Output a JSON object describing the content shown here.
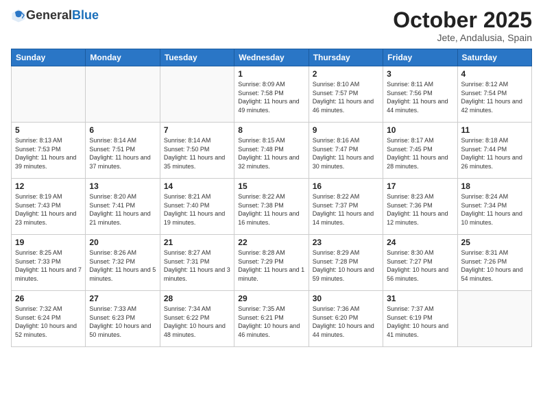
{
  "header": {
    "logo_general": "General",
    "logo_blue": "Blue",
    "month_title": "October 2025",
    "location": "Jete, Andalusia, Spain"
  },
  "days_of_week": [
    "Sunday",
    "Monday",
    "Tuesday",
    "Wednesday",
    "Thursday",
    "Friday",
    "Saturday"
  ],
  "weeks": [
    [
      {
        "day": "",
        "info": ""
      },
      {
        "day": "",
        "info": ""
      },
      {
        "day": "",
        "info": ""
      },
      {
        "day": "1",
        "info": "Sunrise: 8:09 AM\nSunset: 7:58 PM\nDaylight: 11 hours and 49 minutes."
      },
      {
        "day": "2",
        "info": "Sunrise: 8:10 AM\nSunset: 7:57 PM\nDaylight: 11 hours and 46 minutes."
      },
      {
        "day": "3",
        "info": "Sunrise: 8:11 AM\nSunset: 7:56 PM\nDaylight: 11 hours and 44 minutes."
      },
      {
        "day": "4",
        "info": "Sunrise: 8:12 AM\nSunset: 7:54 PM\nDaylight: 11 hours and 42 minutes."
      }
    ],
    [
      {
        "day": "5",
        "info": "Sunrise: 8:13 AM\nSunset: 7:53 PM\nDaylight: 11 hours and 39 minutes."
      },
      {
        "day": "6",
        "info": "Sunrise: 8:14 AM\nSunset: 7:51 PM\nDaylight: 11 hours and 37 minutes."
      },
      {
        "day": "7",
        "info": "Sunrise: 8:14 AM\nSunset: 7:50 PM\nDaylight: 11 hours and 35 minutes."
      },
      {
        "day": "8",
        "info": "Sunrise: 8:15 AM\nSunset: 7:48 PM\nDaylight: 11 hours and 32 minutes."
      },
      {
        "day": "9",
        "info": "Sunrise: 8:16 AM\nSunset: 7:47 PM\nDaylight: 11 hours and 30 minutes."
      },
      {
        "day": "10",
        "info": "Sunrise: 8:17 AM\nSunset: 7:45 PM\nDaylight: 11 hours and 28 minutes."
      },
      {
        "day": "11",
        "info": "Sunrise: 8:18 AM\nSunset: 7:44 PM\nDaylight: 11 hours and 26 minutes."
      }
    ],
    [
      {
        "day": "12",
        "info": "Sunrise: 8:19 AM\nSunset: 7:43 PM\nDaylight: 11 hours and 23 minutes."
      },
      {
        "day": "13",
        "info": "Sunrise: 8:20 AM\nSunset: 7:41 PM\nDaylight: 11 hours and 21 minutes."
      },
      {
        "day": "14",
        "info": "Sunrise: 8:21 AM\nSunset: 7:40 PM\nDaylight: 11 hours and 19 minutes."
      },
      {
        "day": "15",
        "info": "Sunrise: 8:22 AM\nSunset: 7:38 PM\nDaylight: 11 hours and 16 minutes."
      },
      {
        "day": "16",
        "info": "Sunrise: 8:22 AM\nSunset: 7:37 PM\nDaylight: 11 hours and 14 minutes."
      },
      {
        "day": "17",
        "info": "Sunrise: 8:23 AM\nSunset: 7:36 PM\nDaylight: 11 hours and 12 minutes."
      },
      {
        "day": "18",
        "info": "Sunrise: 8:24 AM\nSunset: 7:34 PM\nDaylight: 11 hours and 10 minutes."
      }
    ],
    [
      {
        "day": "19",
        "info": "Sunrise: 8:25 AM\nSunset: 7:33 PM\nDaylight: 11 hours and 7 minutes."
      },
      {
        "day": "20",
        "info": "Sunrise: 8:26 AM\nSunset: 7:32 PM\nDaylight: 11 hours and 5 minutes."
      },
      {
        "day": "21",
        "info": "Sunrise: 8:27 AM\nSunset: 7:31 PM\nDaylight: 11 hours and 3 minutes."
      },
      {
        "day": "22",
        "info": "Sunrise: 8:28 AM\nSunset: 7:29 PM\nDaylight: 11 hours and 1 minute."
      },
      {
        "day": "23",
        "info": "Sunrise: 8:29 AM\nSunset: 7:28 PM\nDaylight: 10 hours and 59 minutes."
      },
      {
        "day": "24",
        "info": "Sunrise: 8:30 AM\nSunset: 7:27 PM\nDaylight: 10 hours and 56 minutes."
      },
      {
        "day": "25",
        "info": "Sunrise: 8:31 AM\nSunset: 7:26 PM\nDaylight: 10 hours and 54 minutes."
      }
    ],
    [
      {
        "day": "26",
        "info": "Sunrise: 7:32 AM\nSunset: 6:24 PM\nDaylight: 10 hours and 52 minutes."
      },
      {
        "day": "27",
        "info": "Sunrise: 7:33 AM\nSunset: 6:23 PM\nDaylight: 10 hours and 50 minutes."
      },
      {
        "day": "28",
        "info": "Sunrise: 7:34 AM\nSunset: 6:22 PM\nDaylight: 10 hours and 48 minutes."
      },
      {
        "day": "29",
        "info": "Sunrise: 7:35 AM\nSunset: 6:21 PM\nDaylight: 10 hours and 46 minutes."
      },
      {
        "day": "30",
        "info": "Sunrise: 7:36 AM\nSunset: 6:20 PM\nDaylight: 10 hours and 44 minutes."
      },
      {
        "day": "31",
        "info": "Sunrise: 7:37 AM\nSunset: 6:19 PM\nDaylight: 10 hours and 41 minutes."
      },
      {
        "day": "",
        "info": ""
      }
    ]
  ]
}
